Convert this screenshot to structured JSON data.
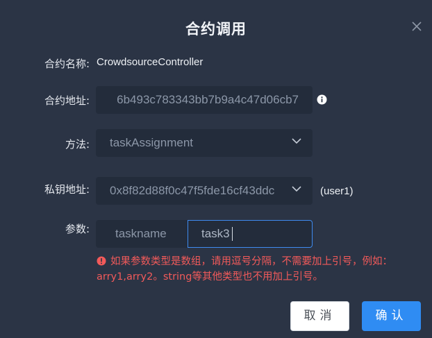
{
  "dialog": {
    "title": "合约调用"
  },
  "fields": {
    "contract_name_label": "合约名称:",
    "contract_name_value": "CrowdsourceController",
    "contract_address_label": "合约地址:",
    "contract_address_value": "6b493c783343bb7b9a4c47d06cb7",
    "method_label": "方法:",
    "method_value": "taskAssignment",
    "key_address_label": "私钥地址:",
    "key_address_value": "0x8f82d88f0c47f5fde16cf43ddc",
    "key_address_suffix": "(user1)",
    "params_label": "参数:",
    "param_name": "taskname",
    "param_value": "task3"
  },
  "hint": {
    "line1": "如果参数类型是数组，请用逗号分隔，不需要加上引号，例如：",
    "line2": "arry1,arry2。string等其他类型也不用加上引号。"
  },
  "buttons": {
    "cancel_label": "取消",
    "ok_label": "确认"
  },
  "colors": {
    "background": "#2b3445",
    "field_bg": "#232c3b",
    "accent": "#2f8cf3",
    "error": "#f25a5a"
  },
  "icons": [
    "close-icon",
    "info-icon",
    "chevron-down-icon",
    "error-icon"
  ]
}
